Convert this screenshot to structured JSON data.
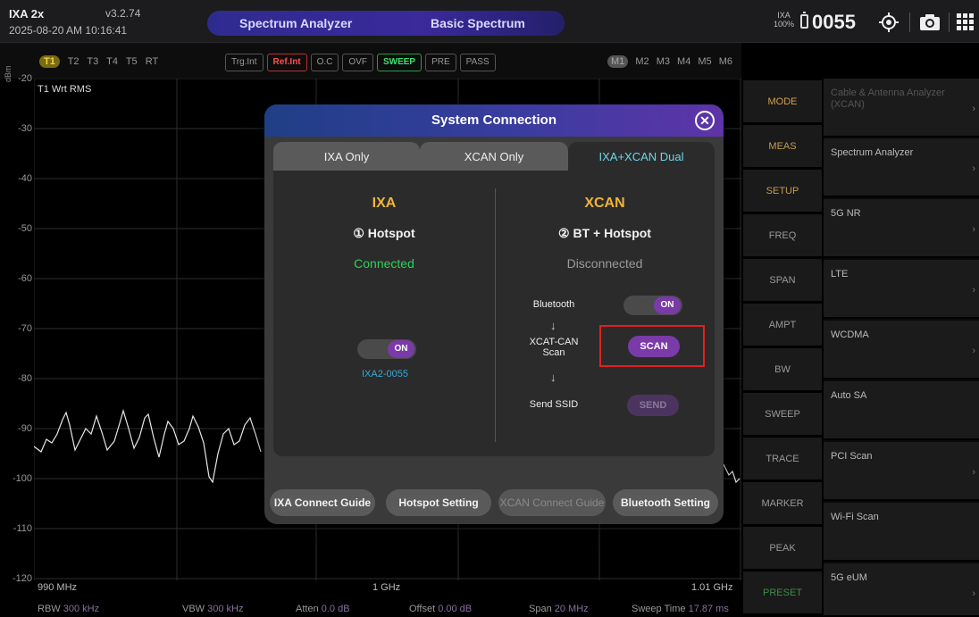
{
  "header": {
    "model": "IXA 2x",
    "version": "v3.2.74",
    "datetime": "2025-08-20 AM 10:16:41",
    "mode_label": "Spectrum Analyzer",
    "submode_label": "Basic Spectrum",
    "ixa_mini_top": "IXA",
    "ixa_mini_bottom": "100%",
    "device_counter": "0055"
  },
  "subbar": {
    "traces": [
      "T1",
      "T2",
      "T3",
      "T4",
      "T5",
      "RT"
    ],
    "flags": [
      "Trg.Int",
      "Ref.Int",
      "O.C",
      "OVF",
      "SWEEP",
      "PRE",
      "PASS"
    ],
    "markers": [
      "M1",
      "M2",
      "M3",
      "M4",
      "M5",
      "M6"
    ]
  },
  "graph": {
    "unit": "dBm",
    "trace_label": "T1 Wrt RMS",
    "y_ticks": [
      "-20",
      "-30",
      "-40",
      "-50",
      "-60",
      "-70",
      "-80",
      "-90",
      "-100",
      "-110",
      "-120"
    ],
    "freq_start": "990 MHz",
    "freq_center": "1 GHz",
    "freq_stop": "1.01 GHz"
  },
  "footer": {
    "rbw_label": "RBW",
    "rbw_value": "300 kHz",
    "vbw_label": "VBW",
    "vbw_value": "300 kHz",
    "atten_label": "Atten",
    "atten_value": "0.0 dB",
    "offset_label": "Offset",
    "offset_value": "0.00 dB",
    "span_label": "Span",
    "span_value": "20 MHz",
    "sweep_label": "Sweep Time",
    "sweep_value": "17.87 ms"
  },
  "softkeys": [
    "MODE",
    "MEAS",
    "SETUP",
    "FREQ",
    "SPAN",
    "AMPT",
    "BW",
    "SWEEP",
    "TRACE",
    "MARKER",
    "PEAK",
    "PRESET"
  ],
  "menu": [
    "Cable & Antenna Analyzer (XCAN)",
    "Spectrum Analyzer",
    "5G NR",
    "LTE",
    "WCDMA",
    "Auto SA",
    "PCI Scan",
    "Wi-Fi Scan",
    "5G eUM"
  ],
  "dialog": {
    "title": "System Connection",
    "tabs": [
      "IXA Only",
      "XCAN Only",
      "IXA+XCAN Dual"
    ],
    "left_title": "IXA",
    "left_step": "① Hotspot",
    "left_status": "Connected",
    "left_toggle": "ON",
    "left_device": "IXA2-0055",
    "right_title": "XCAN",
    "right_step": "② BT + Hotspot",
    "right_status": "Disconnected",
    "bluetooth_label": "Bluetooth",
    "bluetooth_toggle": "ON",
    "scan_label": "XCAT-CAN Scan",
    "scan_button": "SCAN",
    "ssid_label": "Send SSID",
    "send_button": "SEND",
    "buttons": [
      "IXA Connect Guide",
      "Hotspot Setting",
      "XCAN Connect Guide",
      "Bluetooth Setting"
    ]
  },
  "colors": {
    "accent_purple": "#7a3aa8",
    "connected_green": "#2fd05a",
    "highlight_red": "#e0211e",
    "title_gold": "#f0b43a"
  }
}
